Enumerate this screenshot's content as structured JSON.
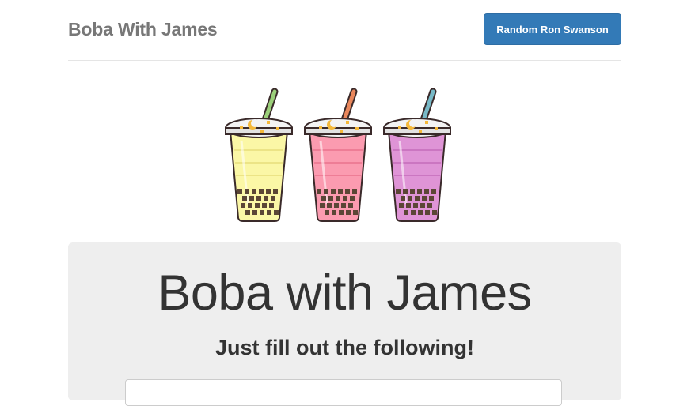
{
  "header": {
    "brand": "Boba With James",
    "button_label": "Random Ron Swanson"
  },
  "hero": {
    "cups": [
      {
        "tea_color": "#fbf7a6",
        "tea_shade": "#ece486",
        "straw_color": "#9bcf7a"
      },
      {
        "tea_color": "#fb9bb0",
        "tea_shade": "#ee7d96",
        "straw_color": "#e9875c"
      },
      {
        "tea_color": "#df94d6",
        "tea_shade": "#cb76c1",
        "straw_color": "#78b9c7"
      }
    ]
  },
  "jumbotron": {
    "title": "Boba with James",
    "subtitle": "Just fill out the following!"
  },
  "colors": {
    "primary": "#337ab7",
    "jumbotron_bg": "#eeeeee",
    "brand_text": "#777777"
  }
}
